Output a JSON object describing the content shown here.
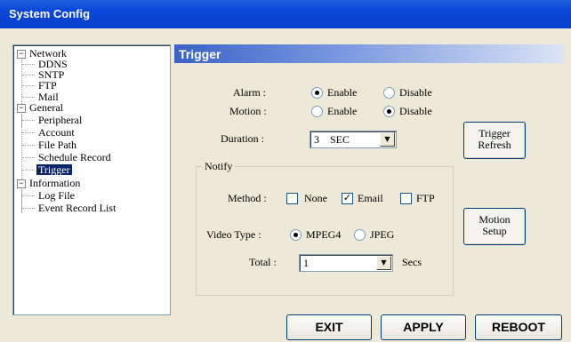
{
  "window": {
    "title": "System Config"
  },
  "tree": {
    "network": {
      "label": "Network",
      "expander": "−",
      "children": [
        "DDNS",
        "SNTP",
        "FTP",
        "Mail"
      ]
    },
    "general": {
      "label": "General",
      "expander": "−",
      "children": [
        "Peripheral",
        "Account",
        "File Path",
        "Schedule Record",
        "Trigger"
      ]
    },
    "information": {
      "label": "Information",
      "expander": "−",
      "children": [
        "Log File",
        "Event Record List"
      ]
    },
    "selected": "Trigger"
  },
  "panel": {
    "header": "Trigger",
    "alarm": {
      "label": "Alarm :",
      "enable": "Enable",
      "disable": "Disable",
      "value": "Enable"
    },
    "motion": {
      "label": "Motion :",
      "enable": "Enable",
      "disable": "Disable",
      "value": "Disable"
    },
    "duration": {
      "label": "Duration :",
      "value": "3    SEC"
    },
    "notify": {
      "title": "Notify",
      "method_label": "Method :",
      "method_none": "None",
      "method_email": "Email",
      "method_ftp": "FTP",
      "method_checked": {
        "none": false,
        "email": true,
        "ftp": false
      },
      "check_mark": "✓",
      "video_type_label": "Video Type :",
      "video_mpeg4": "MPEG4",
      "video_jpeg": "JPEG",
      "video_value": "MPEG4",
      "total_label": "Total :",
      "total_value": "1",
      "total_unit": "Secs"
    },
    "trigger_refresh": {
      "line1": "Trigger",
      "line2": "Refresh"
    },
    "motion_setup": {
      "line1": "Motion",
      "line2": "Setup"
    }
  },
  "footer": {
    "exit": "EXIT",
    "apply": "APPLY",
    "reboot": "REBOOT"
  },
  "icons": {
    "dropdown": "▼"
  }
}
